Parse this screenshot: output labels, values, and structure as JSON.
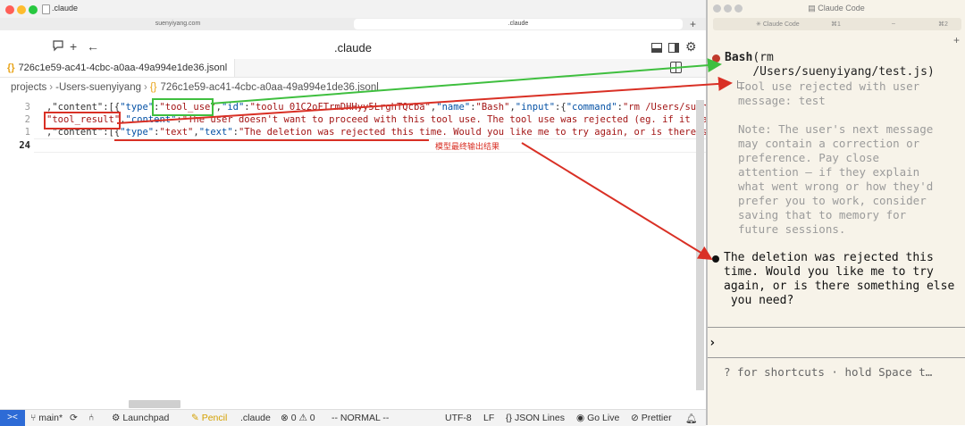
{
  "editor": {
    "window_title": ".claude",
    "url_tabs": [
      "suenyiyang.com",
      ".claude"
    ],
    "toolbar_title": ".claude",
    "file_tab": "726c1e59-ac41-4cbc-a0aa-49a994e1de36.jsonl",
    "breadcrumb": [
      "projects",
      "-Users-suenyiyang",
      "726c1e59-ac41-4cbc-a0aa-49a994e1de36.jsonl"
    ],
    "line_numbers": [
      "3",
      "2",
      "1",
      "24"
    ],
    "code_lines": [
      [
        {
          "t": ",\"content\":[{",
          "c": "p"
        },
        {
          "t": "\"type\"",
          "c": "k"
        },
        {
          "t": ":",
          "c": "p"
        },
        {
          "t": "\"tool_use\"",
          "c": "s"
        },
        {
          "t": ",",
          "c": "p"
        },
        {
          "t": "\"id\"",
          "c": "k"
        },
        {
          "t": ":",
          "c": "p"
        },
        {
          "t": "\"toolu_01C2oFTrmDHHyy5LrghTQcba\"",
          "c": "s"
        },
        {
          "t": ",",
          "c": "p"
        },
        {
          "t": "\"name\"",
          "c": "k"
        },
        {
          "t": ":",
          "c": "p"
        },
        {
          "t": "\"Bash\"",
          "c": "s"
        },
        {
          "t": ",",
          "c": "p"
        },
        {
          "t": "\"input\"",
          "c": "k"
        },
        {
          "t": ":{",
          "c": "p"
        },
        {
          "t": "\"command\"",
          "c": "k"
        },
        {
          "t": ":",
          "c": "p"
        },
        {
          "t": "\"rm /Users/suenyiyang",
          "c": "s"
        }
      ],
      [
        {
          "t": "\"tool_result\"",
          "c": "s"
        },
        {
          "t": ",",
          "c": "p"
        },
        {
          "t": "\"content\"",
          "c": "k"
        },
        {
          "t": ":",
          "c": "p"
        },
        {
          "t": "\"The user doesn't want to proceed with this tool use. The tool use was rejected (eg. if it was a fi",
          "c": "s"
        }
      ],
      [
        {
          "t": ",\"content\":[{",
          "c": "p"
        },
        {
          "t": "\"type\"",
          "c": "k"
        },
        {
          "t": ":",
          "c": "p"
        },
        {
          "t": "\"text\"",
          "c": "s"
        },
        {
          "t": ",",
          "c": "p"
        },
        {
          "t": "\"text\"",
          "c": "k"
        },
        {
          "t": ":",
          "c": "p"
        },
        {
          "t": "\"The deletion was rejected this time. Would you like me to try again, or is there somethi",
          "c": "s"
        }
      ]
    ],
    "annotation": "模型最终输出结果",
    "status": {
      "branch": "main*",
      "launchpad": "Launchpad",
      "pencil": "Pencil",
      "folder": ".claude",
      "problems": "⊗ 0 ⚠ 0",
      "mode": "-- NORMAL --",
      "encoding": "UTF-8",
      "eol": "LF",
      "language": "JSON Lines",
      "golive": "Go Live",
      "prettier": "Prettier"
    }
  },
  "claude": {
    "window_title": "Claude Code",
    "tab_label": "Claude Code",
    "tab_shortcut_1": "⌘1",
    "tab_dash": "–",
    "tab_shortcut_2": "⌘2",
    "tool_name": "Bash",
    "tool_args_1": "(rm",
    "tool_args_2": "/Users/suenyiyang/test.js)",
    "rejected_lines": [
      "Tool use rejected with user",
      "message: test"
    ],
    "note_lines": [
      "Note: The user's next message",
      "may contain a correction or",
      "preference. Pay close",
      "attention – if they explain",
      "what went wrong or how they'd",
      "prefer you to work, consider",
      "saving that to memory for",
      "future sessions."
    ],
    "answer_lines": [
      "The deletion was rejected this",
      "time. Would you like me to try",
      "again, or is there something else",
      " you need?"
    ],
    "prompt": "›",
    "hint": "? for shortcuts · hold Space t…"
  },
  "colors": {
    "green_box": "#3fbf3f",
    "red_box": "#d93025",
    "json_key": "#0451a5",
    "json_string": "#a31515"
  }
}
